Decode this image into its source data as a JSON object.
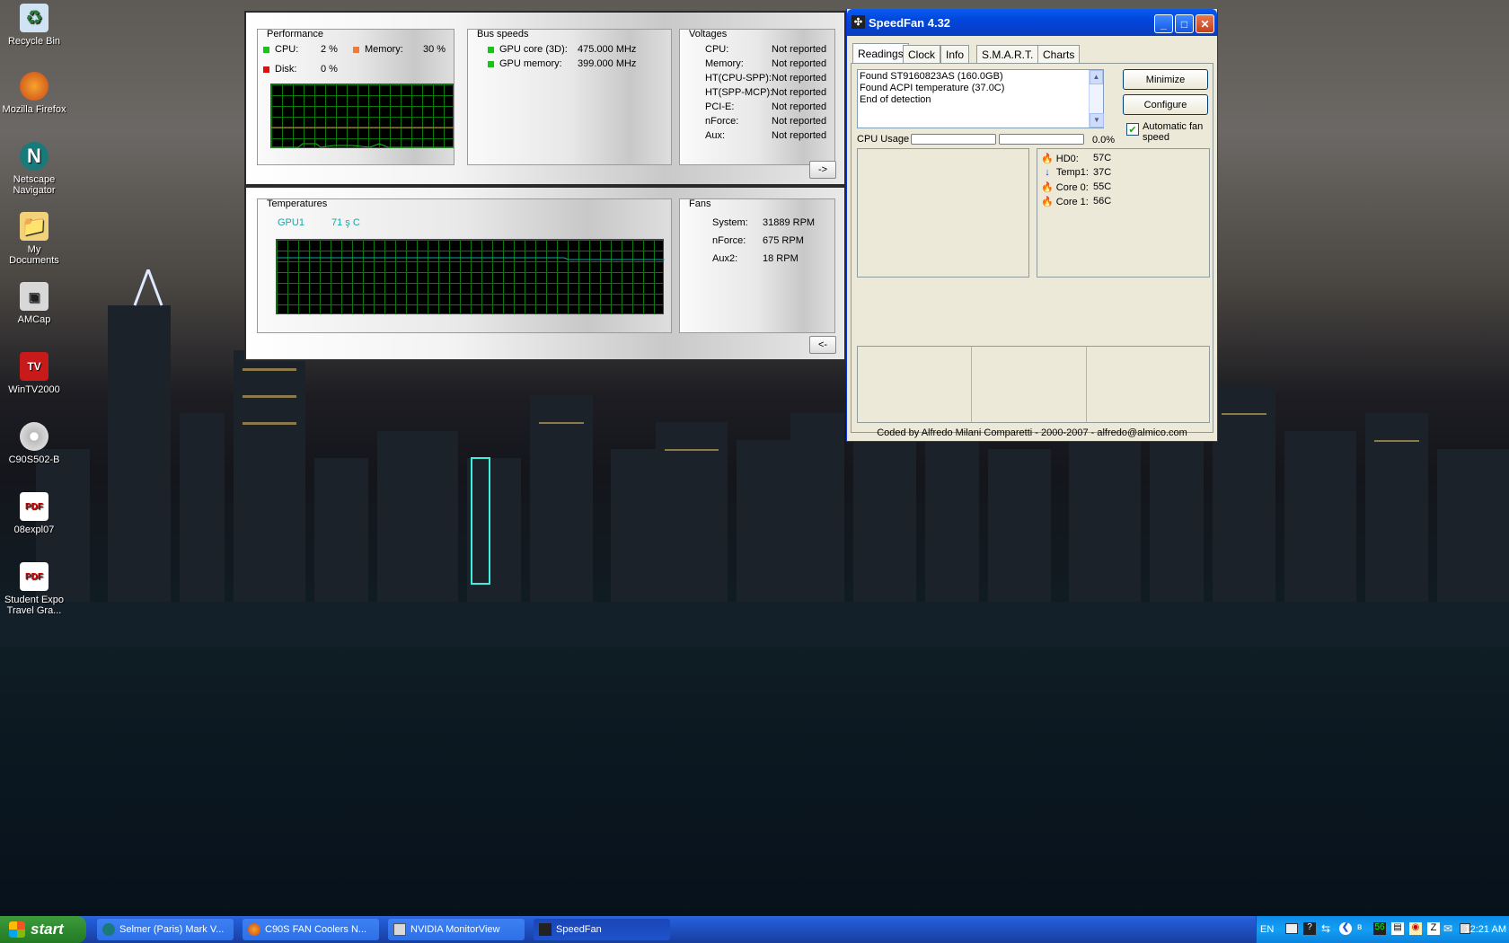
{
  "desktop": {
    "icons": [
      {
        "label": "Recycle Bin",
        "icon": "recycle-bin-icon"
      },
      {
        "label": "Mozilla Firefox",
        "icon": "firefox-icon"
      },
      {
        "label": "Netscape Navigator",
        "icon": "netscape-icon"
      },
      {
        "label": "My Documents",
        "icon": "my-documents-icon"
      },
      {
        "label": "AMCap",
        "icon": "amcap-icon"
      },
      {
        "label": "WinTV2000",
        "icon": "wintv-icon"
      },
      {
        "label": "C90S502-B",
        "icon": "cd-icon"
      },
      {
        "label": "08expl07",
        "icon": "pdf-icon"
      },
      {
        "label": "Student Expo Travel Gra...",
        "icon": "pdf-icon"
      }
    ]
  },
  "monitor": {
    "performance": {
      "title": "Performance",
      "cpu_label": "CPU:",
      "cpu_value": "2 %",
      "memory_label": "Memory:",
      "memory_value": "30 %",
      "disk_label": "Disk:",
      "disk_value": "0 %"
    },
    "bus": {
      "title": "Bus speeds",
      "items": [
        {
          "label": "GPU core (3D):",
          "value": "475.000 MHz"
        },
        {
          "label": "GPU memory:",
          "value": "399.000 MHz"
        }
      ]
    },
    "voltages": {
      "title": "Voltages",
      "items": [
        {
          "label": "CPU:",
          "value": "Not reported"
        },
        {
          "label": "Memory:",
          "value": "Not reported"
        },
        {
          "label": "HT(CPU-SPP):",
          "value": "Not reported"
        },
        {
          "label": "HT(SPP-MCP):",
          "value": "Not reported"
        },
        {
          "label": "PCI-E:",
          "value": "Not reported"
        },
        {
          "label": "nForce:",
          "value": "Not reported"
        },
        {
          "label": "Aux:",
          "value": "Not reported"
        }
      ]
    },
    "expand_label": "->",
    "temperatures": {
      "title": "Temperatures",
      "gpu_label": "GPU1",
      "gpu_value": "71 ş C"
    },
    "fans": {
      "title": "Fans",
      "items": [
        {
          "label": "System:",
          "value": "31889 RPM"
        },
        {
          "label": "nForce:",
          "value": "675 RPM"
        },
        {
          "label": "Aux2:",
          "value": "18 RPM"
        }
      ]
    },
    "collapse_label": "<-"
  },
  "speedfan": {
    "title": "SpeedFan 4.32",
    "tabs": [
      "Readings",
      "Clock",
      "Info",
      "S.M.A.R.T.",
      "Charts"
    ],
    "active_tab": "Readings",
    "log": [
      "Found ST9160823AS (160.0GB)",
      "Found ACPI temperature (37.0C)",
      "End of detection"
    ],
    "minimize_label": "Minimize",
    "configure_label": "Configure",
    "cpu_usage_label": "CPU Usage",
    "cpu_usage_value": "0.0%",
    "auto_fan_label": "Automatic fan speed",
    "auto_fan_checked": true,
    "temps": [
      {
        "label": "HD0:",
        "value": "57C",
        "icon": "flame-icon"
      },
      {
        "label": "Temp1:",
        "value": "37C",
        "icon": "down-arrow-icon"
      },
      {
        "label": "Core 0:",
        "value": "55C",
        "icon": "flame-icon"
      },
      {
        "label": "Core 1:",
        "value": "56C",
        "icon": "flame-icon"
      }
    ],
    "footer": "Coded by Alfredo Milani Comparetti - 2000-2007 - alfredo@almico.com"
  },
  "taskbar": {
    "start_label": "start",
    "tasks": [
      {
        "label": "Selmer (Paris) Mark V...",
        "icon": "netscape-icon"
      },
      {
        "label": "C90S FAN Coolers N...",
        "icon": "firefox-icon"
      },
      {
        "label": "NVIDIA MonitorView",
        "icon": "monitor-icon"
      },
      {
        "label": "SpeedFan",
        "icon": "speedfan-icon"
      }
    ],
    "language": "EN",
    "clock": "12:21 AM"
  },
  "colors": {
    "xp_blue": "#245edb",
    "graph_green": "#0a7a0a",
    "cpu_green": "#19c319",
    "memory_orange": "#f07a3a",
    "disk_red": "#e01010"
  }
}
